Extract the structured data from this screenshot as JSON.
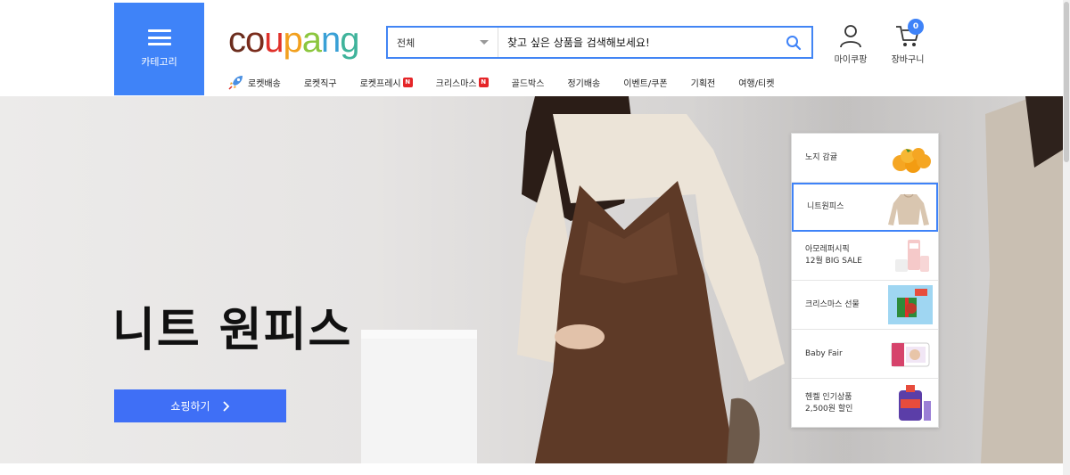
{
  "header": {
    "category_label": "카테고리",
    "logo": [
      {
        "ch": "c",
        "color": "#6b2d1e"
      },
      {
        "ch": "o",
        "color": "#7a2c1c"
      },
      {
        "ch": "u",
        "color": "#e0302a"
      },
      {
        "ch": "p",
        "color": "#f2a01e"
      },
      {
        "ch": "a",
        "color": "#8cc63e"
      },
      {
        "ch": "n",
        "color": "#39a0d6"
      },
      {
        "ch": "g",
        "color": "#3fb39b"
      }
    ],
    "search": {
      "scope": "전체",
      "placeholder": "찾고 싶은 상품을 검색해보세요!"
    },
    "mycoupang_label": "마이쿠팡",
    "cart_label": "장바구니",
    "cart_count": "0",
    "gnb": [
      {
        "label": "로켓배송",
        "icon": "rocket-icon",
        "new": false
      },
      {
        "label": "로켓직구",
        "new": false
      },
      {
        "label": "로켓프레시",
        "new": true
      },
      {
        "label": "크리스마스",
        "new": true
      },
      {
        "label": "골드박스",
        "new": false
      },
      {
        "label": "정기배송",
        "new": false
      },
      {
        "label": "이벤트/쿠폰",
        "new": false
      },
      {
        "label": "기획전",
        "new": false
      },
      {
        "label": "여행/티켓",
        "new": false
      }
    ],
    "new_badge": "N"
  },
  "hero": {
    "title": "니트 원피스",
    "cta_label": "쇼핑하기"
  },
  "promos": [
    {
      "line1": "노지 감귤",
      "line2": "",
      "thumb": "tangerine"
    },
    {
      "line1": "니트원피스",
      "line2": "",
      "thumb": "knit"
    },
    {
      "line1": "아모레퍼시픽",
      "line2": "12월 BIG SALE",
      "thumb": "cosmetics"
    },
    {
      "line1": "크리스마스 선물",
      "line2": "",
      "thumb": "gift"
    },
    {
      "line1": "Baby Fair",
      "line2": "",
      "thumb": "diaper"
    },
    {
      "line1": "헨켈 인기상품",
      "line2": "2,500원 할인",
      "thumb": "detergent"
    }
  ],
  "colors": {
    "accent": "#3f83f8",
    "cta": "#3f6ff6",
    "new_badge": "#e52528"
  }
}
